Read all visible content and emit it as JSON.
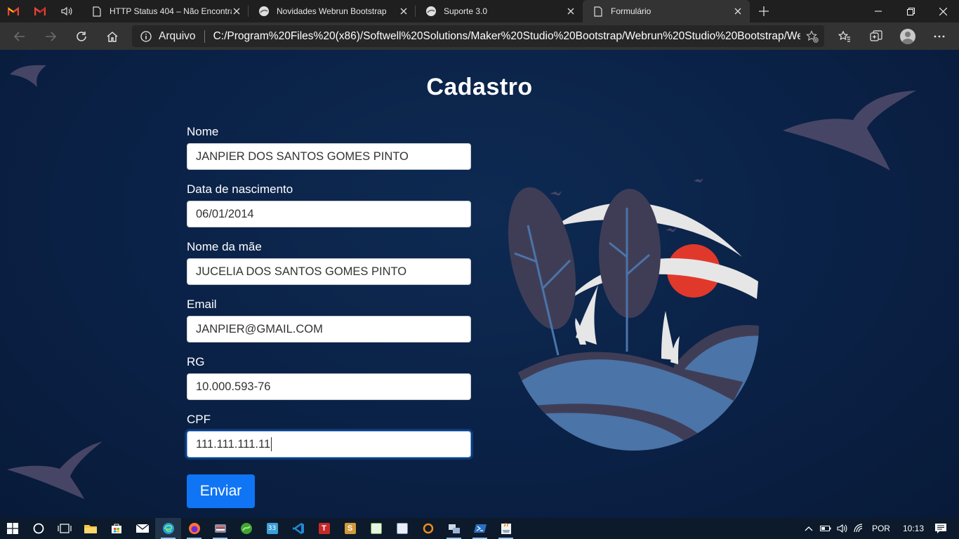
{
  "browser": {
    "tabs": [
      {
        "title": "HTTP Status 404 – Não Encontrado",
        "active": false
      },
      {
        "title": "Novidades Webrun Bootstrap",
        "active": false
      },
      {
        "title": "Suporte 3.0",
        "active": false
      },
      {
        "title": "Formulário",
        "active": true
      }
    ],
    "address": {
      "security_label": "Arquivo",
      "url": "C:/Program%20Files%20(x86)/Softwell%20Solutions/Maker%20Studio%20Bootstrap/Webrun%20Studio%20Bootstrap/Webrun%20Studio%20Bootstrap/formulario.html"
    }
  },
  "form": {
    "title": "Cadastro",
    "fields": [
      {
        "label": "Nome",
        "value": "JANPIER DOS SANTOS GOMES PINTO"
      },
      {
        "label": "Data de nascimento",
        "value": "06/01/2014"
      },
      {
        "label": "Nome da mãe",
        "value": "JUCELIA DOS SANTOS GOMES PINTO"
      },
      {
        "label": "Email",
        "value": "JANPIER@GMAIL.COM"
      },
      {
        "label": "RG",
        "value": "10.000.593-76"
      },
      {
        "label": "CPF",
        "value": "111.111.111.11"
      }
    ],
    "submit_label": "Enviar"
  },
  "taskbar": {
    "language": "POR",
    "time": "10:13"
  },
  "colors": {
    "page_background": "#0b2447",
    "primary_button": "#0f75f5",
    "illustration_dark_leaf": "#3f3d56",
    "illustration_water": "#4b74a8",
    "illustration_sun": "#e0392b"
  }
}
